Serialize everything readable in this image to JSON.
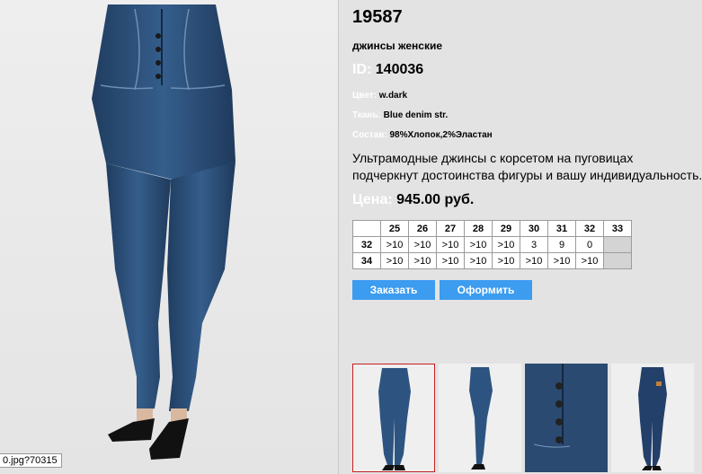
{
  "product": {
    "sku": "19587",
    "name": "джинсы женские",
    "id_label": "ID:",
    "id_value": "140036",
    "props": [
      {
        "label": "Цвет:",
        "value": "w.dark"
      },
      {
        "label": "Ткань:",
        "value": "Blue denim str."
      },
      {
        "label": "Состав:",
        "value": "98%Хлопок,2%Эластан"
      }
    ],
    "description_line1": "Ультрамодные джинсы с корсетом на пуговицах",
    "description_line2": "подчеркнут достоинства фигуры и вашу индивидуальность.",
    "price_label": "Цена:",
    "price_value": "945.00 руб."
  },
  "sizes": {
    "columns": [
      "25",
      "26",
      "27",
      "28",
      "29",
      "30",
      "31",
      "32",
      "33"
    ],
    "rows": [
      {
        "length": "32",
        "stock": [
          ">10",
          ">10",
          ">10",
          ">10",
          ">10",
          "3",
          "9",
          "0",
          ""
        ]
      },
      {
        "length": "34",
        "stock": [
          ">10",
          ">10",
          ">10",
          ">10",
          ">10",
          ">10",
          ">10",
          ">10",
          ""
        ]
      }
    ]
  },
  "buttons": {
    "order": "Заказать",
    "checkout": "Оформить"
  },
  "status_tip": "0.jpg?70315",
  "colors": {
    "background": "#e3e3e3",
    "button": "#3c9cf0",
    "label_white": "#ffffff",
    "active_thumb_border": "#c81e1e",
    "denim": "#2b4f7a"
  },
  "images": {
    "main": "jeans-main-photo",
    "thumbnails": [
      "jeans-front-thumb",
      "jeans-side-thumb",
      "jeans-closeup-thumb",
      "jeans-back-thumb"
    ]
  }
}
